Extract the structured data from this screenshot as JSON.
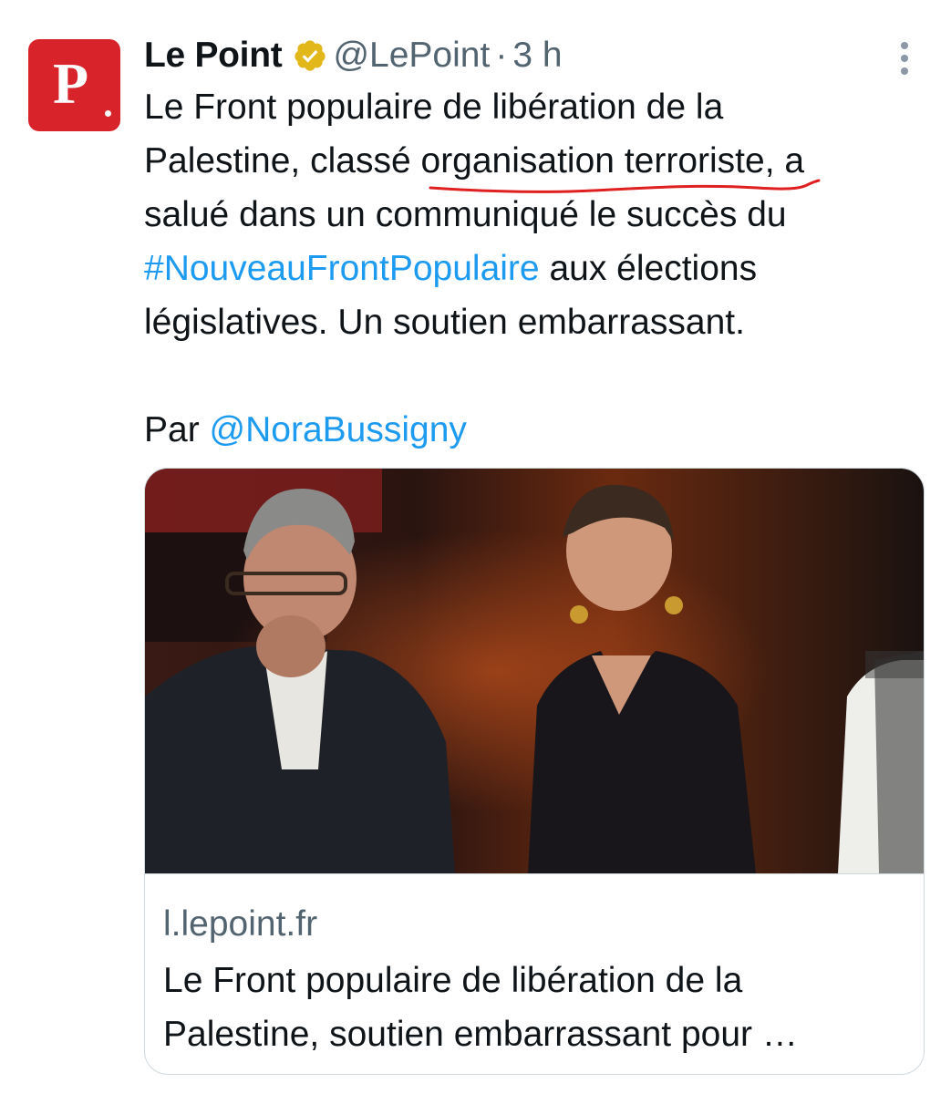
{
  "tweet": {
    "avatar_letter": "P",
    "display_name": "Le Point",
    "handle": "@LePoint",
    "separator": "·",
    "time": "3 h",
    "verified_icon": "verified-gold-badge-icon",
    "more_icon": "more-vertical-icon",
    "text": {
      "line1": "Le Front populaire de libération de la",
      "line2_before": "Palestine, classé ",
      "line2_highlight": "organisation terroriste",
      "line2_after": ", a",
      "line3": "salué dans un communiqué le succès du",
      "hashtag": "#NouveauFrontPopulaire",
      "line4_after": " aux élections",
      "line5": "législatives. Un soutien embarrassant.",
      "by_prefix": "Par ",
      "mention": "@NoraBussigny"
    },
    "annotation_color": "#e02020",
    "link_color": "#1d9bf0"
  },
  "card": {
    "image": "news-photo",
    "domain": "l.lepoint.fr",
    "title_line1": "Le Front populaire de libération de la",
    "title_line2": "Palestine, soutien embarrassant pour …"
  },
  "colors": {
    "brand_red": "#d9232b",
    "verified_gold": "#e2b719",
    "secondary_text": "#536471"
  }
}
